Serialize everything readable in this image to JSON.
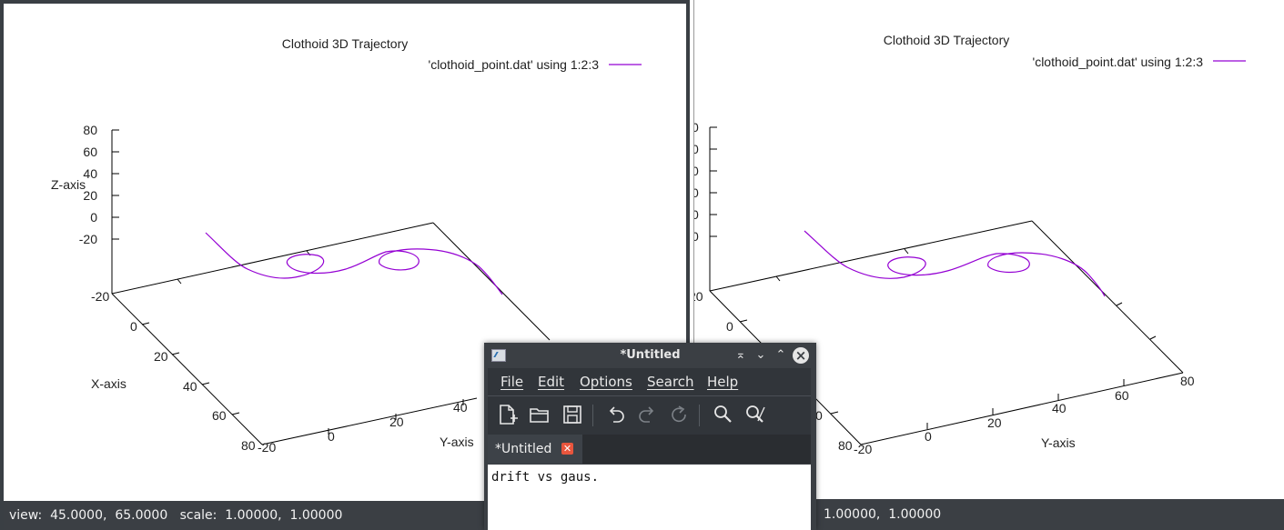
{
  "left_plot": {
    "title": "Clothoid 3D Trajectory",
    "legend": "'clothoid_point.dat' using 1:2:3",
    "zlabel": "Z-axis",
    "xlabel": "X-axis",
    "ylabel": "Y-axis",
    "z_ticks": [
      "80",
      "60",
      "40",
      "20",
      "0",
      "-20"
    ],
    "x_ticks": [
      "-20",
      "0",
      "20",
      "40",
      "60",
      "80"
    ],
    "y_ticks": [
      "-20",
      "0",
      "20",
      "40"
    ],
    "status": "view:  45.0000,  65.0000   scale:  1.00000,  1.00000"
  },
  "right_plot": {
    "title": "Clothoid 3D Trajectory",
    "legend": "'clothoid_point.dat' using 1:2:3",
    "xlabel": "Y-axis",
    "x_ticks_left": [
      "20",
      "0",
      "80"
    ],
    "x_corner": "-20",
    "y_ticks": [
      "0",
      "20",
      "40",
      "60",
      "80"
    ],
    "status": "1.00000,  1.00000"
  },
  "editor": {
    "title": "*Untitled",
    "menu": [
      "File",
      "Edit",
      "Options",
      "Search",
      "Help"
    ],
    "tab_label": "*Untitled",
    "content": "drift vs gaus."
  },
  "colors": {
    "curve": "#9400d3",
    "statusbar": "#3b3f44"
  }
}
